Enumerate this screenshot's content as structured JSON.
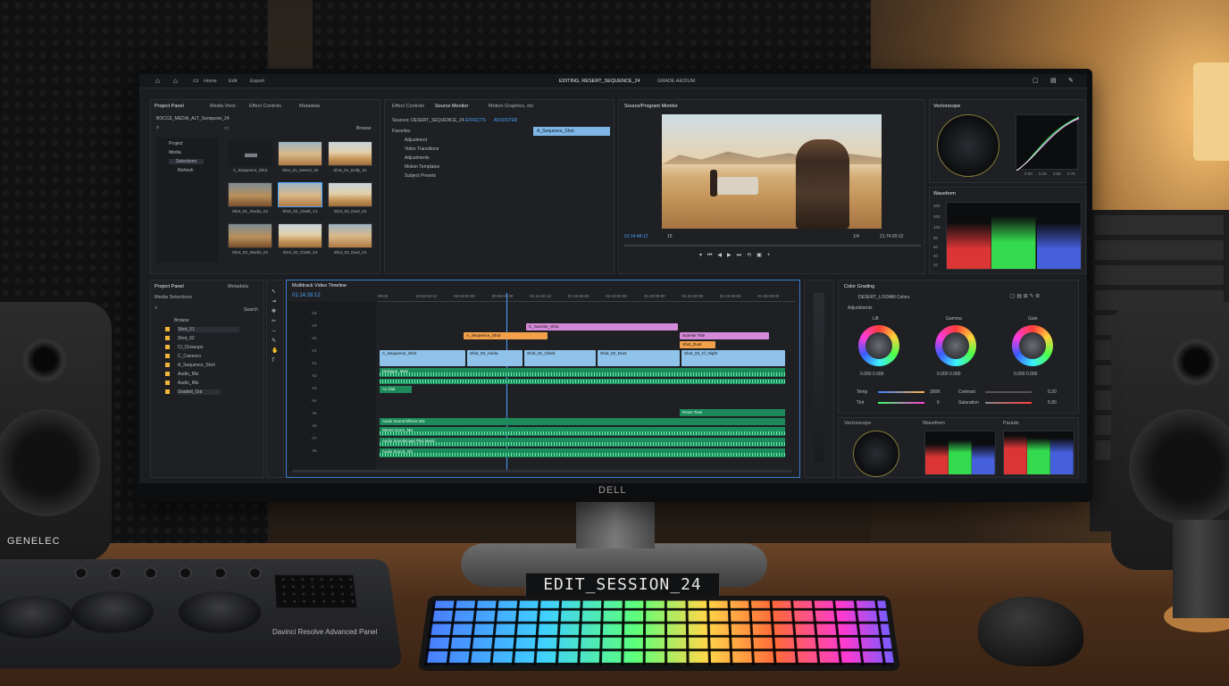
{
  "room": {
    "speaker_brand": "GENELEC",
    "monitor_brand": "DELL",
    "session_display": "EDIT_SESSION_24",
    "control_panel_label": "Davinci Resolve Advanced Panel"
  },
  "menubar": {
    "items": [
      "Home",
      "Edit",
      "Export"
    ],
    "workspace": "EDITING, RESERT_SEQUENCE_24",
    "mode": "GRADE AEDIUM"
  },
  "project_panel": {
    "tabs": [
      "Project Panel",
      "Media Vieni",
      "Effect Controls",
      "Metadata"
    ],
    "project_name": "BOCCE_MEDIA_ALT_Senquese_24",
    "breadcrumb": "Browse",
    "tree": [
      "Project",
      "Media",
      "Selections",
      "Refresh"
    ],
    "thumbnails": [
      {
        "caption": "A_Sequence_Shot"
      },
      {
        "caption": "Shot_01_Desert_02"
      },
      {
        "caption": "Shot_01_Dolly_01"
      },
      {
        "caption": "Shot_01_Studio_01"
      },
      {
        "caption": "Shot_02_Clseb_V1"
      },
      {
        "caption": "Shot_02_Dust_01"
      },
      {
        "caption": "Shot_02_Studio_01"
      },
      {
        "caption": "Shot_02_Closb_01"
      },
      {
        "caption": "Shot_02_Dust_01"
      }
    ]
  },
  "effects_panel": {
    "tabs": [
      "Effect Controls",
      "Source Monitor",
      "Motion Graphics, etc"
    ],
    "sequence_label": "Sources: DESERT_SEQUENCE_24",
    "buttons": [
      "EFFECTS",
      "ADJUSTER"
    ],
    "items": [
      "Favorites",
      "Adjustment",
      "Video Transitions",
      "Adjustments",
      "Motion Templates",
      "Subject Presets"
    ],
    "selected_clip": "A_Sequence_Shot"
  },
  "program_monitor": {
    "title": "Source/Program Monitor",
    "timecode_left": "01:14:48:12",
    "fit": "15",
    "timecode_right": "21:74:20:12",
    "fraction": "1/4"
  },
  "vectorscope": {
    "title": "Vectorscope",
    "curve_labels": [
      "0.00",
      "0.25",
      "0.50",
      "0.75"
    ]
  },
  "waveform": {
    "title": "Waveform",
    "scale": [
      "300",
      "200",
      "100",
      "80",
      "60",
      "40",
      "20"
    ]
  },
  "project_bottom": {
    "tabs": [
      "Project Panel",
      "Media Selections",
      "Metadata"
    ],
    "search_placeholder": "Search",
    "bins": [
      "Browse",
      "Shot_01",
      "Shot_02",
      "Cl_Closeups",
      "C_Canesco",
      "A_Sequence_Shot",
      "Audio_Mix",
      "Audio_Mix",
      "Graded_Out"
    ]
  },
  "timeline": {
    "title": "Multitrack Video Timeline",
    "timecode": "01:14:26:12",
    "ruler": [
      "00:00",
      "00:02:00:12",
      "00:04:00:00",
      "00:06:00:00",
      "01:14:40:12",
      "01:16:00:00",
      "01:18:00:00",
      "01:20:00:00",
      "01:22:00:00",
      "01:24:00:00",
      "01:26:00:00"
    ],
    "track_labels": [
      "V4",
      "V3",
      "V2",
      "V1",
      "A1",
      "A2",
      "A3",
      "A4",
      "A5",
      "A6",
      "A7",
      "A8"
    ],
    "video_clips": [
      {
        "label": "C_Sunrise_Shot",
        "color": "#d58ad8"
      },
      {
        "label": "A_Sequence_Shot",
        "color": "#f2a14a"
      },
      {
        "label": "Sunrise Title",
        "color": "#d58ad8"
      },
      {
        "label": "Shot_Dust",
        "color": "#f2a14a"
      },
      {
        "label": "A_Sequence_Shot",
        "color": "#8fc3ea"
      },
      {
        "label": "Shot_03_Ariela",
        "color": "#8fc3ea"
      },
      {
        "label": "Shot_01_Clseb",
        "color": "#8fc3ea"
      },
      {
        "label": "Shot_02_Dust",
        "color": "#8fc3ea"
      },
      {
        "label": "Shot_03_Cl_Night",
        "color": "#8fc3ea"
      }
    ],
    "audio_clips": [
      {
        "label": "Dialogue_Main"
      },
      {
        "label": "A1 Dial"
      },
      {
        "label": "Room Tone"
      },
      {
        "label": "Audio Sound Effects Mix"
      },
      {
        "label": "Stems Score_Mix"
      },
      {
        "label": "Audio Soundscape Plus Music"
      },
      {
        "label": "Audio Sound_Sfx"
      }
    ]
  },
  "color_panel": {
    "title": "Color Grading",
    "preset": "DESERT_LOOK",
    "mode": "All Colors",
    "section": "Adjustments",
    "wheels": [
      {
        "name": "Lift",
        "value": "0.000 0.000"
      },
      {
        "name": "Gamma",
        "value": "0.000 0.000"
      },
      {
        "name": "Gain",
        "value": "0.000 0.000"
      }
    ],
    "sliders": [
      {
        "name": "Temp",
        "value": "300K"
      },
      {
        "name": "Contrast",
        "value": "0.20"
      },
      {
        "name": "Tint",
        "value": "6"
      },
      {
        "name": "Saturation",
        "value": "5.90"
      }
    ],
    "scopes": [
      "Vectorscope",
      "Waveform",
      "Parade"
    ]
  }
}
